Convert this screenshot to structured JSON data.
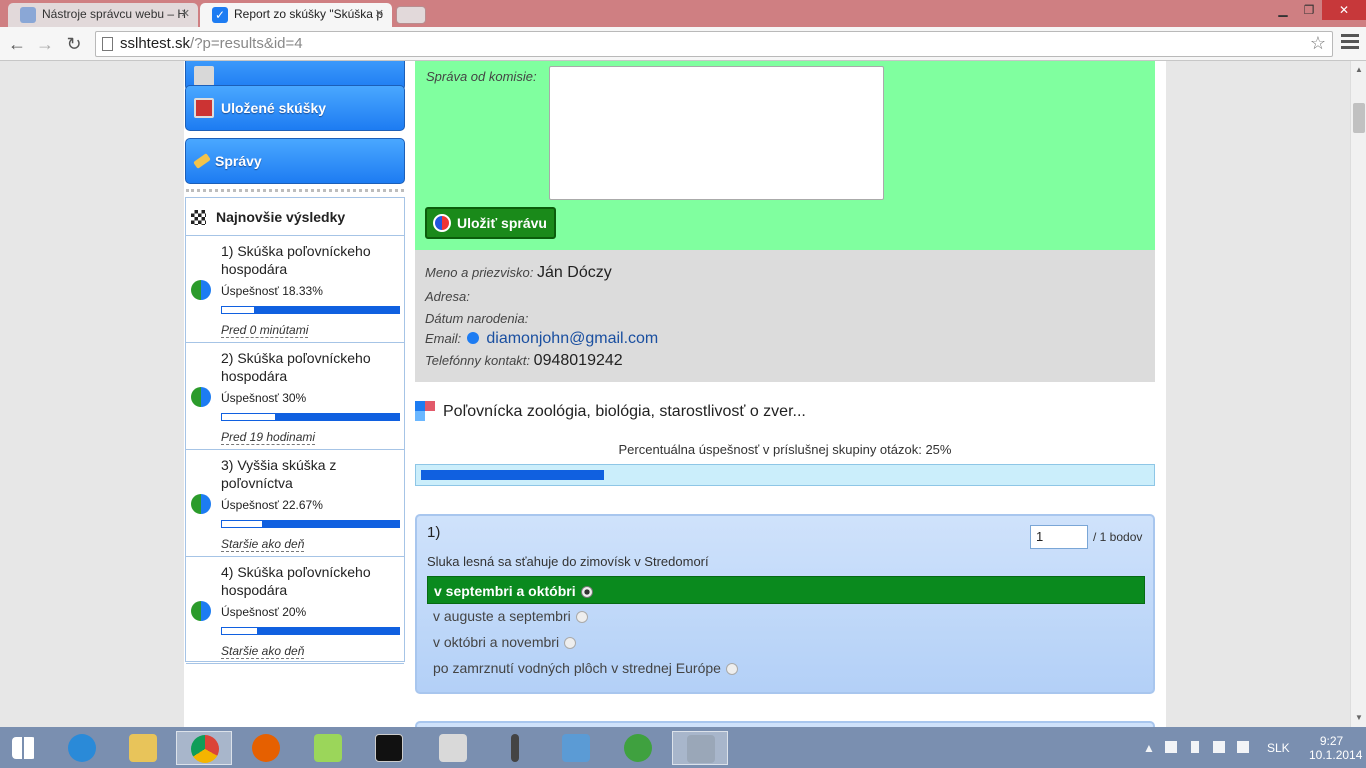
{
  "browser": {
    "tabs": [
      {
        "title": "Nástroje správcu webu – H",
        "active": false
      },
      {
        "title": "Report zo skúšky \"Skúška p",
        "active": true
      }
    ],
    "url_host": "sslhtest.sk",
    "url_path": "/?p=results&id=4"
  },
  "sidebar": {
    "buttons": [
      {
        "label": "Uložené skúšky",
        "icon": "floppy-icon"
      },
      {
        "label": "Správy",
        "icon": "pencil-icon"
      }
    ],
    "results_title": "Najnovšie výsledky",
    "results": [
      {
        "title": "1) Skúška poľovníckeho hospodára",
        "score": "Úspešnosť 18.33%",
        "pct": 18.33,
        "time": "Pred 0 minútami"
      },
      {
        "title": "2) Skúška poľovníckeho hospodára",
        "score": "Úspešnosť 30%",
        "pct": 30,
        "time": "Pred 19 hodinami"
      },
      {
        "title": "3) Vyššia skúška z poľovníctva",
        "score": "Úspešnosť 22.67%",
        "pct": 22.67,
        "time": "Staršie ako deň"
      },
      {
        "title": "4) Skúška poľovníckeho hospodára",
        "score": "Úspešnosť 20%",
        "pct": 20,
        "time": "Staršie ako deň"
      }
    ]
  },
  "commission": {
    "message_label": "Správa od komisie:",
    "save_label": "Uložiť správu"
  },
  "candidate": {
    "name_label": "Meno a priezvisko:",
    "name": "Ján Dóczy",
    "address_label": "Adresa:",
    "birth_label": "Dátum narodenia:",
    "email_label": "Email:",
    "email": "diamonjohn@gmail.com",
    "phone_label": "Telefónny kontakt:",
    "phone": "0948019242"
  },
  "section": {
    "title": "Poľovnícka zoológia, biológia, starostlivosť o zver...",
    "pct_text": "Percentuálna úspešnosť v príslušnej skupiny otázok: 25%",
    "pct": 25
  },
  "question": {
    "number": "1)",
    "points_value": "1",
    "points_suffix": "/ 1 bodov",
    "text": "Sluka lesná sa sťahuje do zimovísk v Stredomorí",
    "answers": [
      {
        "label": "v septembri a októbri",
        "correct": true
      },
      {
        "label": "v auguste a septembri",
        "correct": false
      },
      {
        "label": "v októbri a novembri",
        "correct": false
      },
      {
        "label": "po zamrznutí vodných plôch v strednej Európe",
        "correct": false
      }
    ]
  },
  "tray": {
    "lang": "SLK",
    "time": "9:27",
    "date": "10.1.2014"
  },
  "colors": {
    "green_panel": "#80ff9f",
    "button_blue": "#1d7cf2",
    "correct_answer": "#0a8a1e"
  }
}
